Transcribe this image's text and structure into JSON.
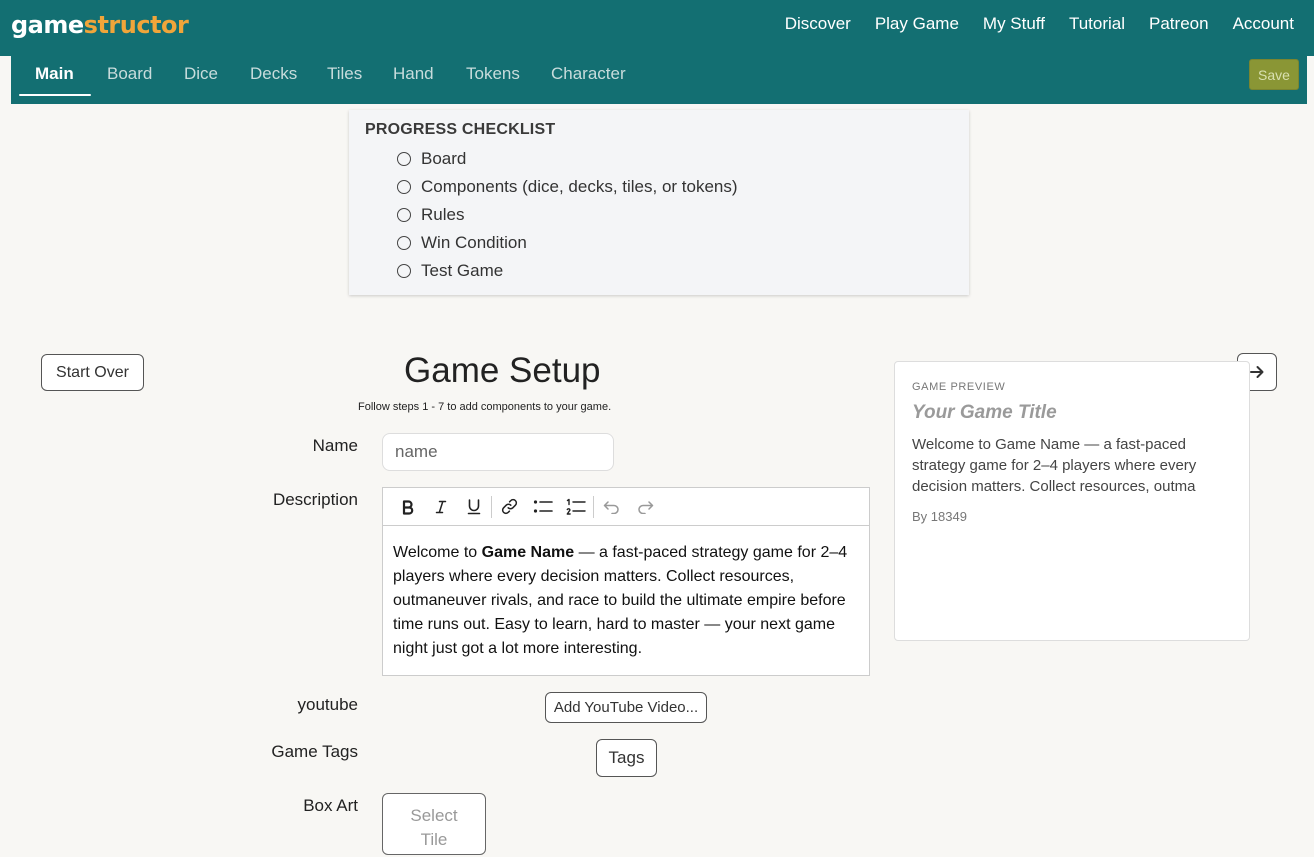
{
  "brand": {
    "part1": "game",
    "part2": "structor"
  },
  "topnav": [
    "Discover",
    "Play Game",
    "My Stuff",
    "Tutorial",
    "Patreon",
    "Account"
  ],
  "tabs": [
    "Main",
    "Board",
    "Dice",
    "Decks",
    "Tiles",
    "Hand",
    "Tokens",
    "Character"
  ],
  "save_label": "Save",
  "checklist": {
    "title": "PROGRESS CHECKLIST",
    "items": [
      "Board",
      "Components (dice, decks, tiles, or tokens)",
      "Rules",
      "Win Condition",
      "Test Game"
    ]
  },
  "start_over": "Start Over",
  "next_icon": "arrow-right-icon",
  "setup": {
    "title": "Game Setup",
    "subtitle": "Follow steps 1 - 7 to add components to your game."
  },
  "form": {
    "name_label": "Name",
    "name_placeholder": "name",
    "description_label": "Description",
    "description": {
      "before": "Welcome to ",
      "bold": "Game Name",
      "after": " — a fast-paced strategy game for 2–4 players where every decision matters. Collect resources, outmaneuver rivals, and race to build the ultimate empire before time runs out. Easy to learn, hard to master — your next game night just got a lot more interesting."
    },
    "toolbar_icons": [
      "bold-icon",
      "italic-icon",
      "underline-icon",
      "link-icon",
      "bullet-list-icon",
      "numbered-list-icon",
      "undo-icon",
      "redo-icon"
    ],
    "youtube_label": "youtube",
    "youtube_button": "Add YouTube Video...",
    "tags_label": "Game Tags",
    "tags_button": "Tags",
    "boxart_label": "Box Art",
    "tile_button_line1": "Select",
    "tile_button_line2": "Tile"
  },
  "preview": {
    "label": "GAME PREVIEW",
    "title": "Your Game Title",
    "description": "Welcome to Game Name — a fast-paced strategy game for 2–4 players where every decision matters. Collect resources, outma",
    "by": "By 18349"
  },
  "colors": {
    "header": "#136f72",
    "brand_accent": "#f0a53a",
    "save": "#8a9635"
  }
}
